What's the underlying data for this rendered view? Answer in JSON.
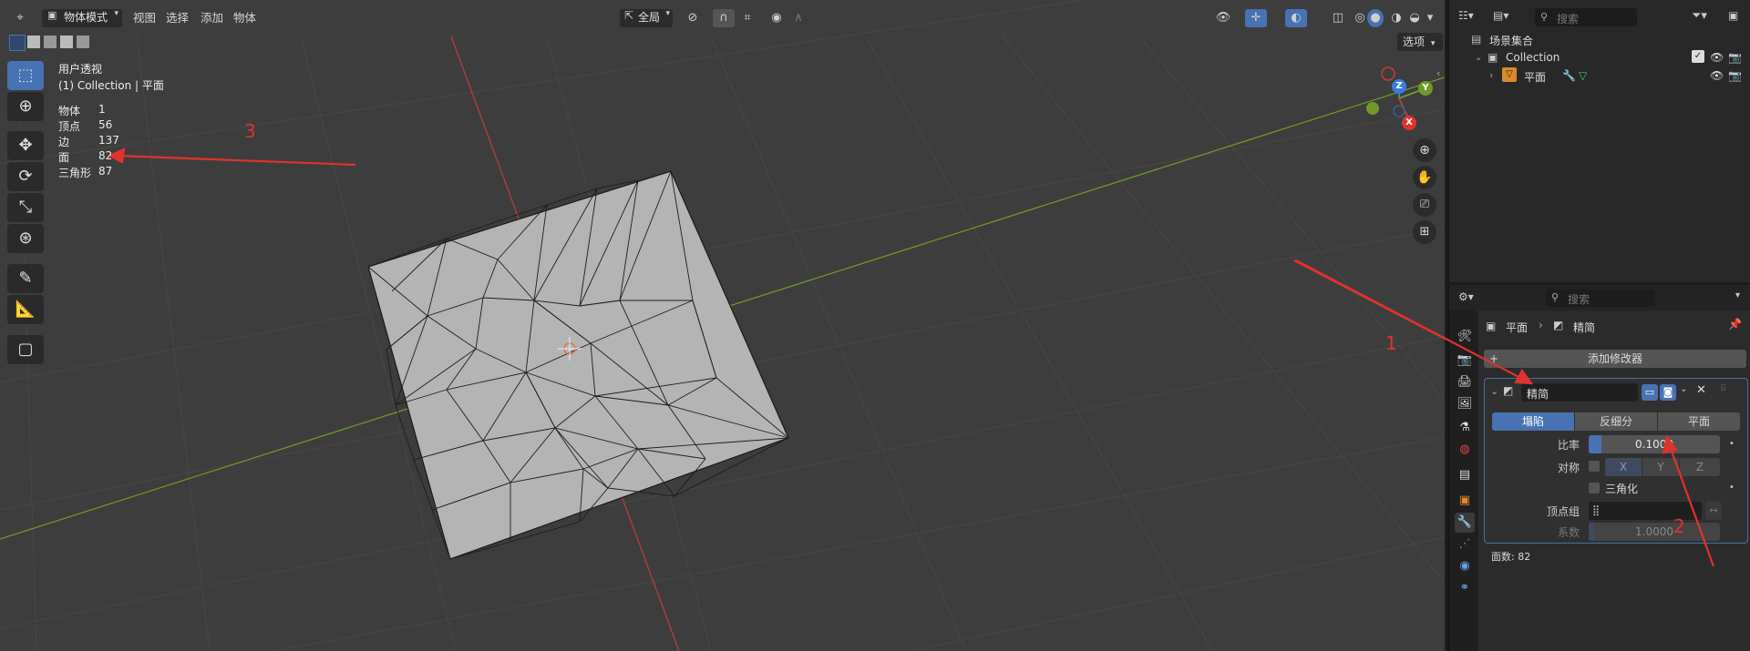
{
  "viewport": {
    "header": {
      "mode_label": "物体模式",
      "menus": [
        "视图",
        "选择",
        "添加",
        "物体"
      ],
      "transform_orientation": "全局",
      "options_label": "选项"
    },
    "overlay": {
      "view_name": "用户透视",
      "collection_line": "(1) Collection | 平面",
      "stats": [
        {
          "key": "物体",
          "value": "1"
        },
        {
          "key": "顶点",
          "value": "56"
        },
        {
          "key": "边",
          "value": "137"
        },
        {
          "key": "面",
          "value": "82"
        },
        {
          "key": "三角形",
          "value": "87"
        }
      ]
    },
    "gizmo": {
      "z": "Z",
      "y": "Y",
      "x": "X"
    },
    "annotations": [
      "3",
      "1",
      "2"
    ],
    "colors": {
      "annotation": "#e0322c",
      "x_axis": "#c53a3a",
      "y_axis": "#6f9a2a",
      "active_tool": "#4772b3"
    }
  },
  "outliner": {
    "search_placeholder": "搜索",
    "scene_collection": "场景集合",
    "collection": "Collection",
    "object": "平面"
  },
  "properties": {
    "search_placeholder": "搜索",
    "breadcrumb_object": "平面",
    "breadcrumb_modifier": "精简",
    "add_modifier": "添加修改器",
    "modifier": {
      "name": "精简",
      "tabs": [
        "塌陷",
        "反细分",
        "平面"
      ],
      "ratio_label": "比率",
      "ratio_value": "0.1000",
      "ratio_fraction": 0.1,
      "symmetry_label": "对称",
      "axes": [
        "X",
        "Y",
        "Z"
      ],
      "triangulate_label": "三角化",
      "vertex_group_label": "顶点组",
      "factor_label": "系数",
      "factor_value": "1.0000",
      "face_count": "面数: 82"
    }
  }
}
